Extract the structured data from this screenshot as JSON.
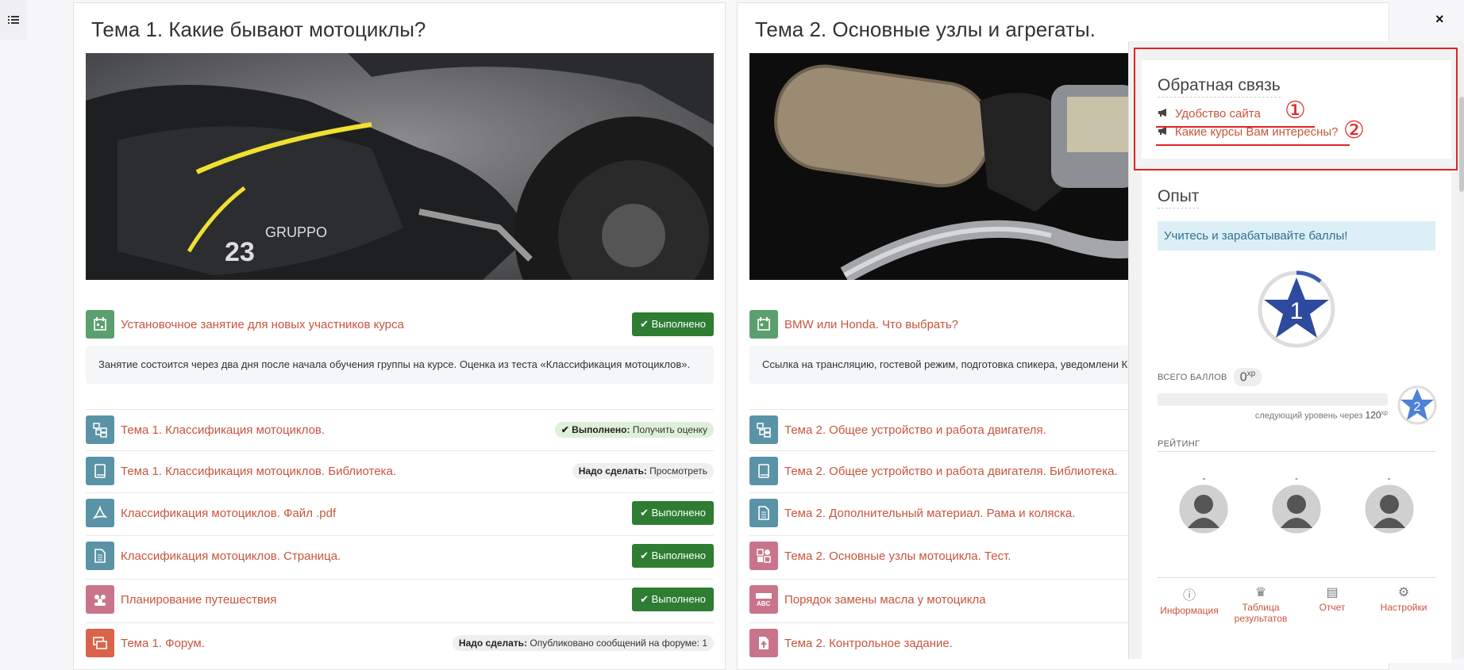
{
  "course": {
    "sections": [
      {
        "title": "Тема 1. Какие бывают мотоциклы?",
        "activities": [
          {
            "name": "Установочное занятие для новых участников курса",
            "status_type": "done",
            "status": "Выполнено",
            "icon": "calendar-icon",
            "color": "#5b9f6e"
          },
          {
            "name": "Тема 1. Классификация мотоциклов.",
            "status_type": "pill-green",
            "status_label": "Выполнено:",
            "status": "Получить оценку",
            "icon": "hierarchy-icon",
            "color": "#5b93a6"
          },
          {
            "name": "Тема 1. Классификация мотоциклов. Библиотека.",
            "status_type": "pill",
            "status_label": "Надо сделать:",
            "status": "Просмотреть",
            "icon": "book-icon",
            "color": "#5b93a6"
          },
          {
            "name": "Классификация мотоциклов. Файл .pdf",
            "status_type": "done",
            "status": "Выполнено",
            "icon": "pdf-icon",
            "color": "#5b93a6"
          },
          {
            "name": "Классификация мотоциклов. Страница.",
            "status_type": "done",
            "status": "Выполнено",
            "icon": "page-icon",
            "color": "#5b93a6"
          },
          {
            "name": "Планирование путешествия",
            "status_type": "done",
            "status": "Выполнено",
            "icon": "group-icon",
            "color": "#c9748a"
          },
          {
            "name": "Тема 1. Форум.",
            "status_type": "pill",
            "status_label": "Надо сделать:",
            "status": "Опубликовано сообщений на форуме: 1",
            "icon": "forum-icon",
            "color": "#d9644a"
          }
        ],
        "description": "Занятие состоится через два дня после начала обучения группы на курсе. Оценка из теста «Классификация мотоциклов»."
      },
      {
        "title": "Тема 2. Основные узлы и агрегаты.",
        "activities": [
          {
            "name": "BMW или Honda. Что выбрать?",
            "icon": "calendar-icon",
            "color": "#5b9f6e"
          },
          {
            "name": "Тема 2. Общее устройство и работа двигателя.",
            "icon": "hierarchy-icon",
            "color": "#5b93a6"
          },
          {
            "name": "Тема 2. Общее устройство и работа двигателя. Библиотека.",
            "icon": "book-icon",
            "color": "#5b93a6"
          },
          {
            "name": "Тема 2. Дополнительный материал. Рама и коляска.",
            "icon": "page-icon",
            "color": "#5b93a6"
          },
          {
            "name": "Тема 2. Основные узлы мотоцикла. Тест.",
            "icon": "quiz-icon",
            "color": "#c9748a"
          },
          {
            "name": "Порядок замены масла у мотоцикла",
            "icon": "abc-icon",
            "color": "#c9748a"
          },
          {
            "name": "Тема 2. Контрольное задание.",
            "icon": "assign-icon",
            "color": "#c9748a"
          }
        ],
        "description": "Ссылка на трансляцию, гостевой режим, подготовка спикера, уведомлени Конференция Trueconf."
      }
    ]
  },
  "drawer": {
    "close": "×",
    "feedback": {
      "title": "Обратная связь",
      "links": [
        "Удобство сайта",
        "Какие курсы Вам интересны?"
      ],
      "markers": [
        "①",
        "②"
      ]
    },
    "xp": {
      "title": "Опыт",
      "alert": "Учитесь и зарабатывайте баллы!",
      "level": "1",
      "total_label": "ВСЕГО БАЛЛОВ",
      "points": "0",
      "xp_unit": "xp",
      "next_level_text": "следующий уровень через",
      "next_level_points": "120",
      "progress_percent": 0,
      "next_level": "2",
      "rating_label": "РЕЙТИНГ",
      "rating_dashes": [
        "-",
        "-",
        "-"
      ],
      "menu": [
        "Информация",
        "Таблица результатов",
        "Отчет",
        "Настройки"
      ]
    }
  }
}
